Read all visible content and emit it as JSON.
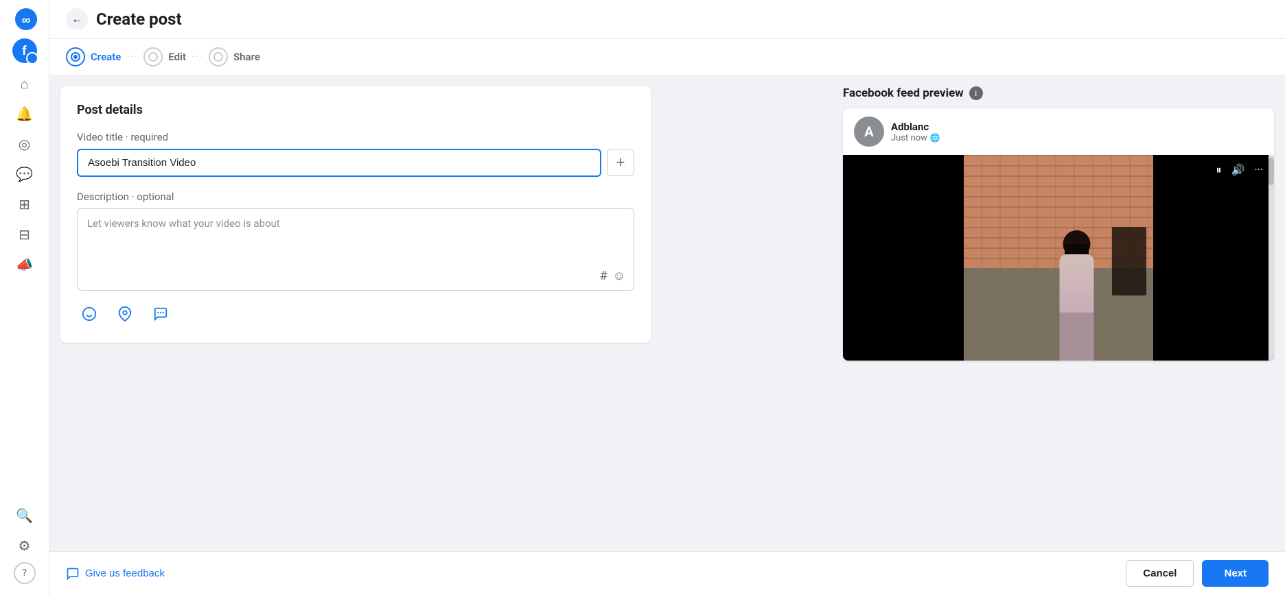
{
  "app": {
    "logo_label": "Meta",
    "title": "Create post"
  },
  "sidebar": {
    "avatar_letter": "f",
    "icons": [
      {
        "name": "home-icon",
        "glyph": "⌂"
      },
      {
        "name": "bell-icon",
        "glyph": "🔔"
      },
      {
        "name": "compass-icon",
        "glyph": "◎"
      },
      {
        "name": "chat-icon",
        "glyph": "💬"
      },
      {
        "name": "grid-icon",
        "glyph": "⊞"
      },
      {
        "name": "table-icon",
        "glyph": "⊟"
      },
      {
        "name": "megaphone-icon",
        "glyph": "📣"
      },
      {
        "name": "search-icon",
        "glyph": "🔍"
      },
      {
        "name": "settings-icon",
        "glyph": "⚙"
      },
      {
        "name": "help-icon",
        "glyph": "?"
      }
    ]
  },
  "header": {
    "back_label": "←",
    "title": "Create post"
  },
  "stepper": {
    "steps": [
      {
        "label": "Create",
        "active": true
      },
      {
        "label": "Edit",
        "active": false
      },
      {
        "label": "Share",
        "active": false
      }
    ],
    "dots": "···"
  },
  "post_details": {
    "card_title": "Post details",
    "video_title_label": "Video title",
    "video_title_required": "· required",
    "video_title_value": "Asoebi Transition Video",
    "add_button_label": "+",
    "description_label": "Description",
    "description_optional": "· optional",
    "description_placeholder": "Let viewers know what your video is about",
    "hashtag_icon": "#",
    "emoji_icon": "☺",
    "action_icons": [
      {
        "name": "emoji-reaction-icon",
        "glyph": "😊"
      },
      {
        "name": "location-icon",
        "glyph": "📍"
      },
      {
        "name": "messenger-icon",
        "glyph": "💬"
      }
    ]
  },
  "preview": {
    "title": "Facebook feed preview",
    "user_name": "Adblanc",
    "user_avatar_letter": "A",
    "post_time": "Just now",
    "globe_icon": "🌐"
  },
  "footer": {
    "feedback_icon": "💬",
    "feedback_label": "Give us feedback",
    "cancel_label": "Cancel",
    "next_label": "Next"
  }
}
